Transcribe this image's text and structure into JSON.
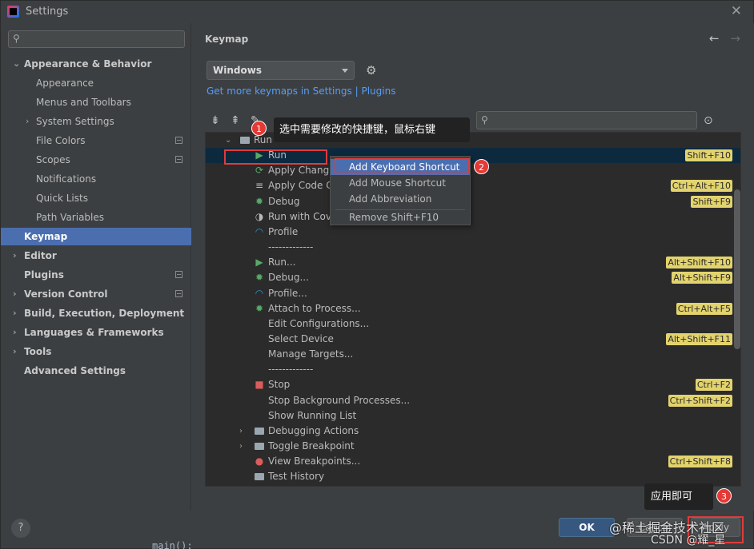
{
  "window": {
    "title": "Settings"
  },
  "sidebar": {
    "search_placeholder": "",
    "items": [
      {
        "label": "Appearance & Behavior",
        "bold": true,
        "arrow": "⌄"
      },
      {
        "label": "Appearance"
      },
      {
        "label": "Menus and Toolbars"
      },
      {
        "label": "System Settings",
        "arrow": "›"
      },
      {
        "label": "File Colors",
        "project": true
      },
      {
        "label": "Scopes",
        "project": true
      },
      {
        "label": "Notifications"
      },
      {
        "label": "Quick Lists"
      },
      {
        "label": "Path Variables"
      },
      {
        "label": "Keymap",
        "bold": true,
        "selected": true
      },
      {
        "label": "Editor",
        "bold": true,
        "arrow": "›"
      },
      {
        "label": "Plugins",
        "bold": true,
        "project": true
      },
      {
        "label": "Version Control",
        "bold": true,
        "arrow": "›",
        "project": true
      },
      {
        "label": "Build, Execution, Deployment",
        "bold": true,
        "arrow": "›"
      },
      {
        "label": "Languages & Frameworks",
        "bold": true,
        "arrow": "›"
      },
      {
        "label": "Tools",
        "bold": true,
        "arrow": "›"
      },
      {
        "label": "Advanced Settings",
        "bold": true
      }
    ]
  },
  "main": {
    "title": "Keymap",
    "keymap_combo": "Windows",
    "link": "Get more keymaps in Settings | Plugins"
  },
  "tree": {
    "rows": [
      {
        "label": "Run",
        "icon": "folder",
        "twisty": "⌄",
        "indent": 0
      },
      {
        "label": "Run",
        "icon": "run",
        "shortcut": "Shift+F10",
        "selected": true
      },
      {
        "label": "Apply Change",
        "icon": "apply"
      },
      {
        "label": "Apply Code Cl",
        "icon": "apply-code",
        "shortcut": "Ctrl+Alt+F10"
      },
      {
        "label": "Debug",
        "icon": "debug",
        "shortcut": "Shift+F9"
      },
      {
        "label": "Run with Cove",
        "icon": "coverage"
      },
      {
        "label": "Profile",
        "icon": "profile"
      },
      {
        "label": "-------------",
        "icon": ""
      },
      {
        "label": "Run...",
        "icon": "run",
        "shortcut": "Alt+Shift+F10"
      },
      {
        "label": "Debug...",
        "icon": "debug",
        "shortcut": "Alt+Shift+F9"
      },
      {
        "label": "Profile...",
        "icon": "profile"
      },
      {
        "label": "Attach to Process...",
        "icon": "attach",
        "shortcut": "Ctrl+Alt+F5"
      },
      {
        "label": "Edit Configurations...",
        "icon": ""
      },
      {
        "label": "Select Device",
        "icon": "",
        "shortcut": "Alt+Shift+F11"
      },
      {
        "label": "Manage Targets...",
        "icon": ""
      },
      {
        "label": "-------------",
        "icon": ""
      },
      {
        "label": "Stop",
        "icon": "stop",
        "shortcut": "Ctrl+F2"
      },
      {
        "label": "Stop Background Processes...",
        "icon": "",
        "shortcut": "Ctrl+Shift+F2"
      },
      {
        "label": "Show Running List",
        "icon": ""
      },
      {
        "label": "Debugging Actions",
        "icon": "folder",
        "twisty": "›"
      },
      {
        "label": "Toggle Breakpoint",
        "icon": "folder",
        "twisty": "›"
      },
      {
        "label": "View Breakpoints...",
        "icon": "breakpoints",
        "shortcut": "Ctrl+Shift+F8"
      },
      {
        "label": "Test History",
        "icon": "folder"
      }
    ]
  },
  "context_menu": {
    "items": [
      "Add Keyboard Shortcut",
      "Add Mouse Shortcut",
      "Add Abbreviation",
      "Remove Shift+F10"
    ]
  },
  "annotations": {
    "step1_text": "选中需要修改的快捷键，鼠标右键",
    "step3_text": "应用即可",
    "badge1": "1",
    "badge2": "2",
    "badge3": "3"
  },
  "footer": {
    "help": "?",
    "ok": "OK",
    "cancel": "Cancel",
    "apply": "Apply"
  },
  "watermark": {
    "line1": "@稀土掘金技术社区",
    "line2": "CSDN @耀_星"
  },
  "code_peek": "main():"
}
